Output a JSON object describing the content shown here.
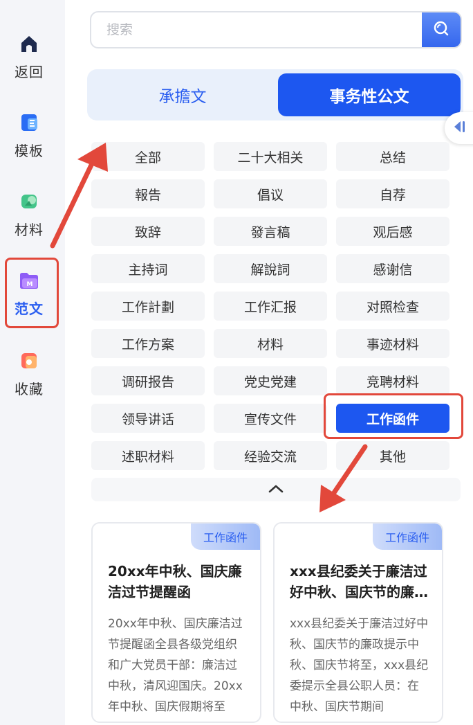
{
  "sidebar": {
    "items": [
      {
        "label": "返回",
        "icon": "home-icon"
      },
      {
        "label": "模板",
        "icon": "template-icon"
      },
      {
        "label": "材料",
        "icon": "material-icon"
      },
      {
        "label": "范文",
        "icon": "folder-icon",
        "active": true
      },
      {
        "label": "收藏",
        "icon": "bookmark-icon"
      }
    ]
  },
  "search": {
    "placeholder": "搜索",
    "value": "",
    "button_icon": "search-icon"
  },
  "tabs": [
    {
      "label": "承擔文",
      "active": false
    },
    {
      "label": "事务性公文",
      "active": true
    }
  ],
  "side_handle_icon": "collapse-panel-icon",
  "categories": [
    "全部",
    "二十大相关",
    "总结",
    "報告",
    "倡议",
    "自荐",
    "致辞",
    "發言稿",
    "观后感",
    "主持词",
    "解說詞",
    "感谢信",
    "工作計劃",
    "工作汇报",
    "对照检查",
    "工作方案",
    "材料",
    "事迹材料",
    "调研报告",
    "党史党建",
    "竞聘材料",
    "领导讲话",
    "宣传文件",
    "工作函件",
    "述职材料",
    "经验交流",
    "其他"
  ],
  "selected_category": "工作函件",
  "collapse_icon": "chevron-up-icon",
  "cards": [
    {
      "tag": "工作函件",
      "title": "20xx年中秋、国庆廉洁过节提醒函",
      "excerpt": "20xx年中秋、国庆廉洁过节提醒函全县各级党组织和广大党员干部：廉洁过中秋，清风迎国庆。20xx年中秋、国庆假期将至"
    },
    {
      "tag": "工作函件",
      "title": "xxx县纪委关于廉洁过好中秋、国庆节的廉政提示",
      "excerpt": "xxx县纪委关于廉洁过好中秋、国庆节的廉政提示中秋、国庆节将至，xxx县纪委提示全县公职人员：在中秋、国庆节期间"
    }
  ],
  "colors": {
    "accent": "#1d57f0",
    "annotation": "#e2483b",
    "sidebar_bg": "#f4f5f9",
    "chip_bg": "#f4f5f7"
  }
}
